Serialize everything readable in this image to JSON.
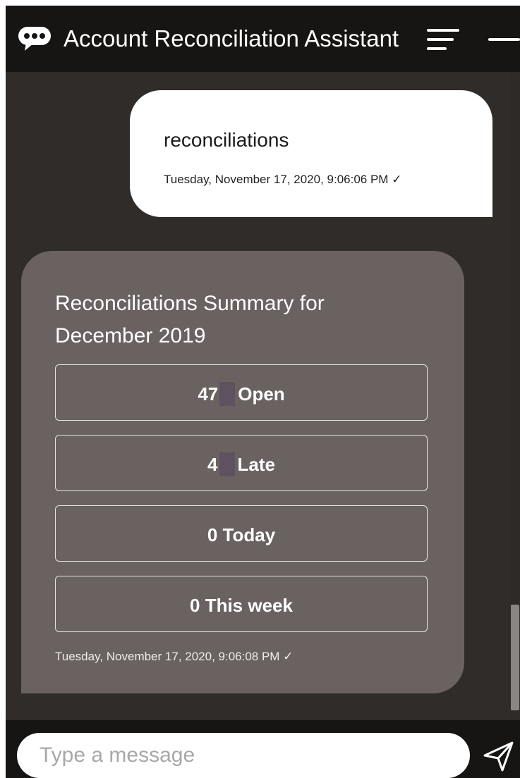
{
  "header": {
    "title": "Account Reconciliation Assistant",
    "icon": "chat-bubble-icon",
    "menu_icon": "hamburger-menu-icon",
    "minimize_icon": "minimize-icon"
  },
  "conversation": {
    "user_message": {
      "text": "reconciliations",
      "timestamp": "Tuesday, November 17, 2020, 9:06:06 PM ✓"
    },
    "bot_message": {
      "title": "Reconciliations Summary for December 2019",
      "buttons": [
        {
          "count": "47",
          "label": "Open"
        },
        {
          "count": "4",
          "label": "Late"
        },
        {
          "text": "0 Today"
        },
        {
          "text": "0 This week"
        }
      ],
      "timestamp": "Tuesday, November 17, 2020, 9:06:08 PM ✓"
    }
  },
  "composer": {
    "placeholder": "Type a message",
    "send_icon": "send-icon"
  },
  "colors": {
    "header_bg": "#171514",
    "conversation_bg": "#302c2a",
    "bot_bubble_bg": "#6a6260",
    "user_bubble_bg": "#ffffff",
    "count_chip": "#5e5260"
  }
}
